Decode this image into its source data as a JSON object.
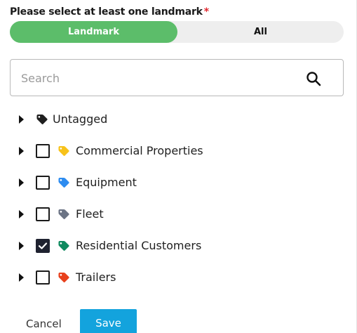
{
  "prompt": {
    "text": "Please select at least one landmark",
    "required_mark": "*",
    "required_color": "#e0262d"
  },
  "toggle": {
    "options": [
      {
        "label": "Landmark",
        "selected": true
      },
      {
        "label": "All",
        "selected": false
      }
    ],
    "active_color": "#5cbd6a",
    "track_color": "#eeeeee"
  },
  "search": {
    "placeholder": "Search",
    "value": "",
    "icon": "search-icon"
  },
  "tree": {
    "items": [
      {
        "label": "Untagged",
        "has_checkbox": false,
        "checked": false,
        "tag_color": "#1f1f1f",
        "icon": "tag-icon"
      },
      {
        "label": "Commercial Properties",
        "has_checkbox": true,
        "checked": false,
        "tag_color": "#f7c21a",
        "icon": "tag-icon"
      },
      {
        "label": "Equipment",
        "has_checkbox": true,
        "checked": false,
        "tag_color": "#2d8cf0",
        "icon": "tag-icon"
      },
      {
        "label": "Fleet",
        "has_checkbox": true,
        "checked": false,
        "tag_color": "#6b7384",
        "icon": "tag-icon"
      },
      {
        "label": "Residential Customers",
        "has_checkbox": true,
        "checked": true,
        "tag_color": "#0f8a5f",
        "icon": "tag-icon"
      },
      {
        "label": "Trailers",
        "has_checkbox": true,
        "checked": false,
        "tag_color": "#e8401c",
        "icon": "tag-icon"
      }
    ]
  },
  "actions": {
    "cancel_label": "Cancel",
    "save_label": "Save",
    "save_color": "#13a3dd"
  }
}
